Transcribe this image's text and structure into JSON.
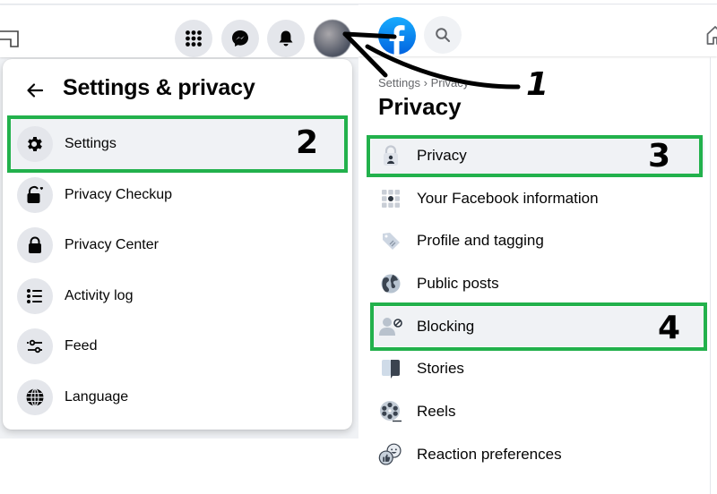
{
  "left_panel": {
    "topbar": {
      "icons": [
        "menu-grid-icon",
        "messenger-icon",
        "notifications-bell-icon",
        "profile-avatar"
      ]
    },
    "menu": {
      "title": "Settings & privacy",
      "back_icon": "back-arrow-icon",
      "items": [
        {
          "label": "Settings",
          "icon": "gear-icon",
          "highlighted": true
        },
        {
          "label": "Privacy Checkup",
          "icon": "lock-heart-icon"
        },
        {
          "label": "Privacy Center",
          "icon": "lock-icon"
        },
        {
          "label": "Activity log",
          "icon": "list-icon"
        },
        {
          "label": "Feed",
          "icon": "sliders-icon"
        },
        {
          "label": "Language",
          "icon": "globe-icon"
        }
      ]
    }
  },
  "right_panel": {
    "topbar": {
      "icons": [
        "facebook-logo",
        "search-icon",
        "home-icon"
      ]
    },
    "breadcrumb": [
      "Settings",
      "›",
      "Privacy"
    ],
    "title": "Privacy",
    "items": [
      {
        "label": "Privacy",
        "icon": "privacy-lock-icon",
        "highlighted": true
      },
      {
        "label": "Your Facebook information",
        "icon": "facebook-info-grid-icon"
      },
      {
        "label": "Profile and tagging",
        "icon": "tag-icon"
      },
      {
        "label": "Public posts",
        "icon": "globe-icon"
      },
      {
        "label": "Blocking",
        "icon": "block-user-icon",
        "highlighted": true
      },
      {
        "label": "Stories",
        "icon": "stories-icon"
      },
      {
        "label": "Reels",
        "icon": "reels-icon"
      },
      {
        "label": "Reaction preferences",
        "icon": "reactions-icon"
      }
    ]
  },
  "annotations": {
    "steps": [
      "1",
      "2",
      "3",
      "4"
    ],
    "highlight_color": "#22b14c"
  },
  "colors": {
    "facebook_blue": "#1877f2",
    "icon_bg": "#e4e6eb",
    "hover_bg": "#f0f2f5",
    "secondary_text": "#65676b"
  }
}
